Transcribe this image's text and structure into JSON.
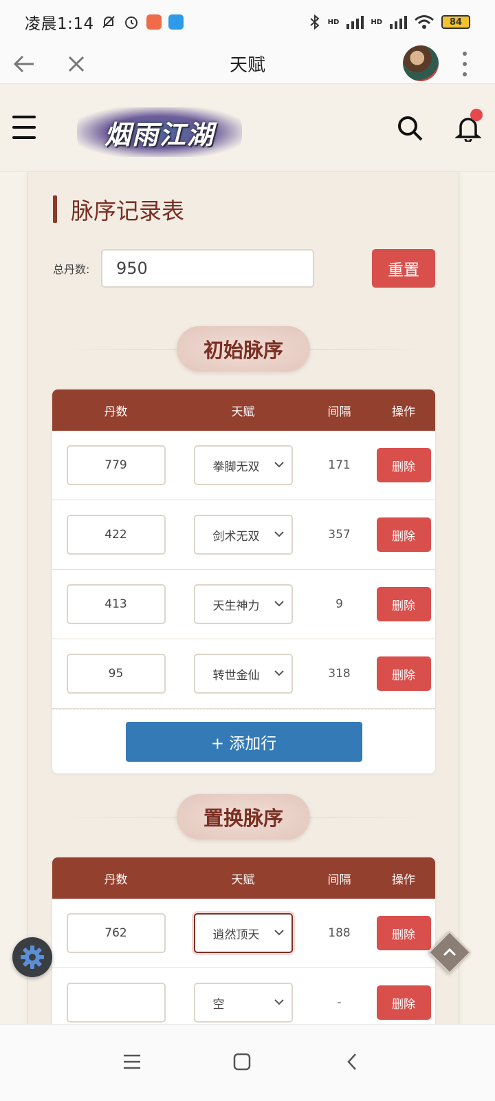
{
  "status_bar": {
    "time": "凌晨1:14",
    "battery": "84",
    "signal_label_1": "HD",
    "signal_label_2": "HD"
  },
  "browser": {
    "title": "天赋",
    "back_icon": "arrow-left-icon",
    "close_icon": "close-icon",
    "menu_icon": "kebab-menu-icon"
  },
  "site": {
    "logo_text": "烟雨江湖",
    "menu_icon": "hamburger-icon",
    "search_icon": "search-icon",
    "notification_icon": "bell-icon"
  },
  "panel": {
    "title": "脉序记录表",
    "total_label": "总丹数:",
    "total_value": "950",
    "reset_label": "重置"
  },
  "initial": {
    "section_title": "初始脉序",
    "headers": {
      "dan": "丹数",
      "talent": "天赋",
      "gap": "间隔",
      "op": "操作"
    },
    "rows": [
      {
        "dan": "779",
        "talent": "拳脚无双",
        "gap": "171",
        "op": "删除"
      },
      {
        "dan": "422",
        "talent": "剑术无双",
        "gap": "357",
        "op": "删除"
      },
      {
        "dan": "413",
        "talent": "天生神力",
        "gap": "9",
        "op": "删除"
      },
      {
        "dan": "95",
        "talent": "转世金仙",
        "gap": "318",
        "op": "删除"
      }
    ],
    "add_label": "+ 添加行"
  },
  "replace": {
    "section_title": "置换脉序",
    "headers": {
      "dan": "丹数",
      "talent": "天赋",
      "gap": "间隔",
      "op": "操作"
    },
    "rows": [
      {
        "dan": "762",
        "talent": "逍然顶天",
        "gap": "188",
        "op": "删除"
      },
      {
        "dan": "",
        "talent": "空",
        "gap": "-",
        "op": "删除"
      }
    ]
  },
  "colors": {
    "header_brown": "#94402f",
    "delete_red": "#d94f4c",
    "add_blue": "#337ab7",
    "title_brown": "#7a2f22"
  }
}
